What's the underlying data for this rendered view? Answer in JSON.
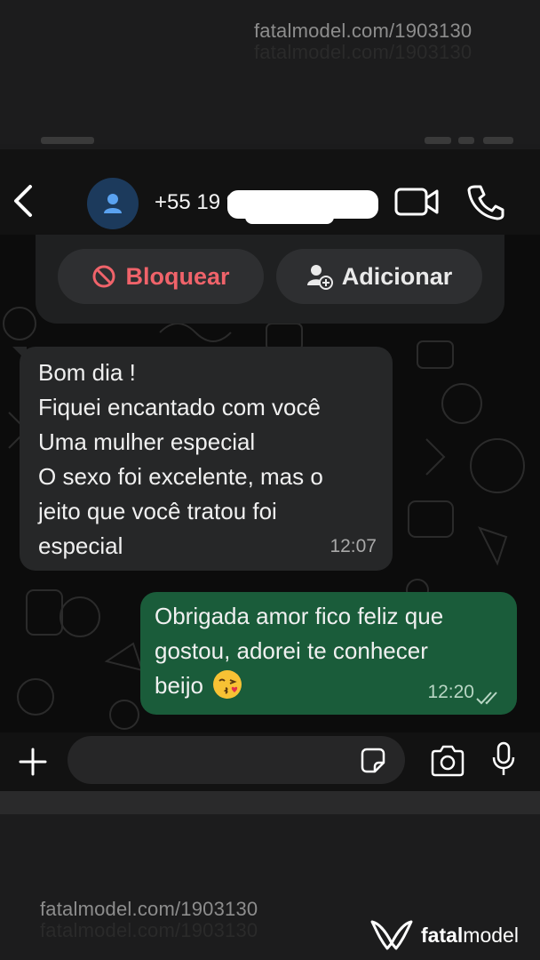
{
  "watermark": {
    "top_text": "fatalmodel.com/1903130",
    "bottom_text": "fatalmodel.com/1903130",
    "brand_bold": "fatal",
    "brand_rest": "model"
  },
  "header": {
    "contact_name": "+55 19 9",
    "icons": [
      "back-arrow-icon",
      "avatar-person-icon",
      "video-call-icon",
      "phone-call-icon"
    ]
  },
  "actions": {
    "block_label": "Bloquear",
    "add_label": "Adicionar"
  },
  "messages": [
    {
      "direction": "incoming",
      "lines": [
        "Bom dia !",
        "Fiquei encantado com você",
        "Uma mulher especial",
        "O sexo foi excelente, mas o",
        "jeito que você tratou foi",
        "especial"
      ],
      "time": "12:07"
    },
    {
      "direction": "outgoing",
      "lines": [
        "Obrigada amor fico feliz que",
        "gostou, adorei te conhecer",
        "beijo"
      ],
      "emoji": "face-blowing-kiss",
      "time": "12:20",
      "status": "read"
    }
  ],
  "composer": {
    "value": "",
    "placeholder": ""
  },
  "colors": {
    "outgoing_bubble": "#1a5c3a",
    "incoming_bubble": "#262728",
    "block_red": "#f0636a",
    "avatar_blue": "#1c3a5c"
  }
}
